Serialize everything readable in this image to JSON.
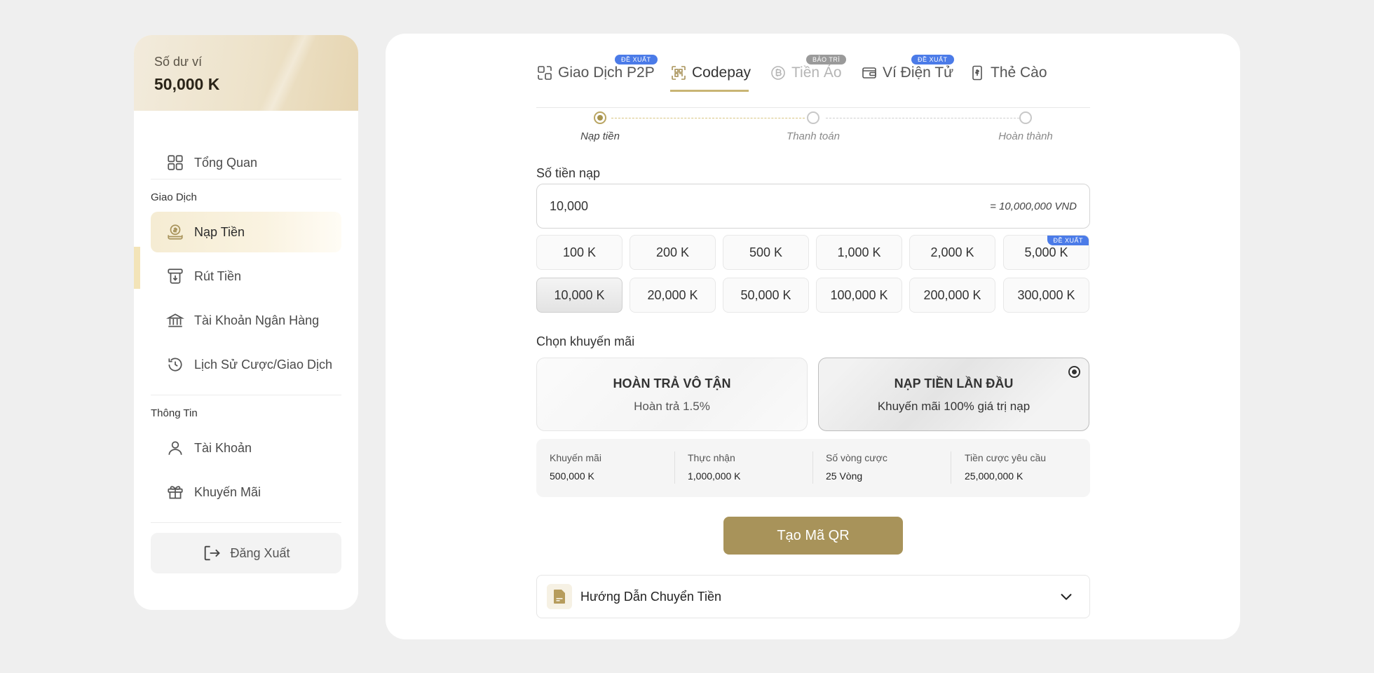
{
  "sidebar": {
    "balance_label": "Số dư ví",
    "balance_value": "50,000 K",
    "overview": "Tổng Quan",
    "section_transactions": "Giao Dịch",
    "deposit": "Nạp Tiền",
    "withdraw": "Rút Tiền",
    "bank_account": "Tài Khoản Ngân Hàng",
    "history": "Lịch Sử Cược/Giao Dịch",
    "section_info": "Thông Tin",
    "account": "Tài Khoản",
    "promotions": "Khuyến Mãi",
    "logout": "Đăng Xuất"
  },
  "tabs": {
    "p2p": "Giao Dịch P2P",
    "p2p_badge": "ĐỀ XUẤT",
    "codepay": "Codepay",
    "crypto": "Tiền Ảo",
    "crypto_badge": "BẢO TRÌ",
    "ewallet": "Ví Điện Tử",
    "ewallet_badge": "ĐỀ XUẤT",
    "card": "Thẻ Cào"
  },
  "steps": {
    "deposit": "Nạp tiền",
    "payment": "Thanh toán",
    "complete": "Hoàn thành"
  },
  "amount": {
    "label": "Số tiền nạp",
    "value": "10,000",
    "converted": "= 10,000,000 VND"
  },
  "chips": {
    "c1": "100 K",
    "c2": "200 K",
    "c3": "500 K",
    "c4": "1,000 K",
    "c5": "2,000 K",
    "c6": "5,000 K",
    "c6_badge": "ĐỀ XUẤT",
    "c7": "10,000 K",
    "c8": "20,000 K",
    "c9": "50,000 K",
    "c10": "100,000 K",
    "c11": "200,000 K",
    "c12": "300,000 K"
  },
  "promo": {
    "label": "Chọn khuyến mãi",
    "p1_title": "HOÀN TRẢ VÔ TẬN",
    "p1_sub": "Hoàn trả 1.5%",
    "p2_title": "NẠP TIỀN LẦN ĐẦU",
    "p2_sub": "Khuyến mãi 100% giá trị nạp"
  },
  "summary": {
    "k1": "Khuyến mãi",
    "v1": "500,000 K",
    "k2": "Thực nhận",
    "v2": "1,000,000 K",
    "k3": "Số vòng cược",
    "v3": "25 Vòng",
    "k4": "Tiền cược yêu cầu",
    "v4": "25,000,000 K"
  },
  "qr_button": "Tạo Mã QR",
  "guide": "Hướng Dẫn Chuyển Tiền",
  "colors": {
    "accent": "#a8935a",
    "badge_blue": "#4b7be8",
    "badge_gray": "#9a9a9a"
  }
}
